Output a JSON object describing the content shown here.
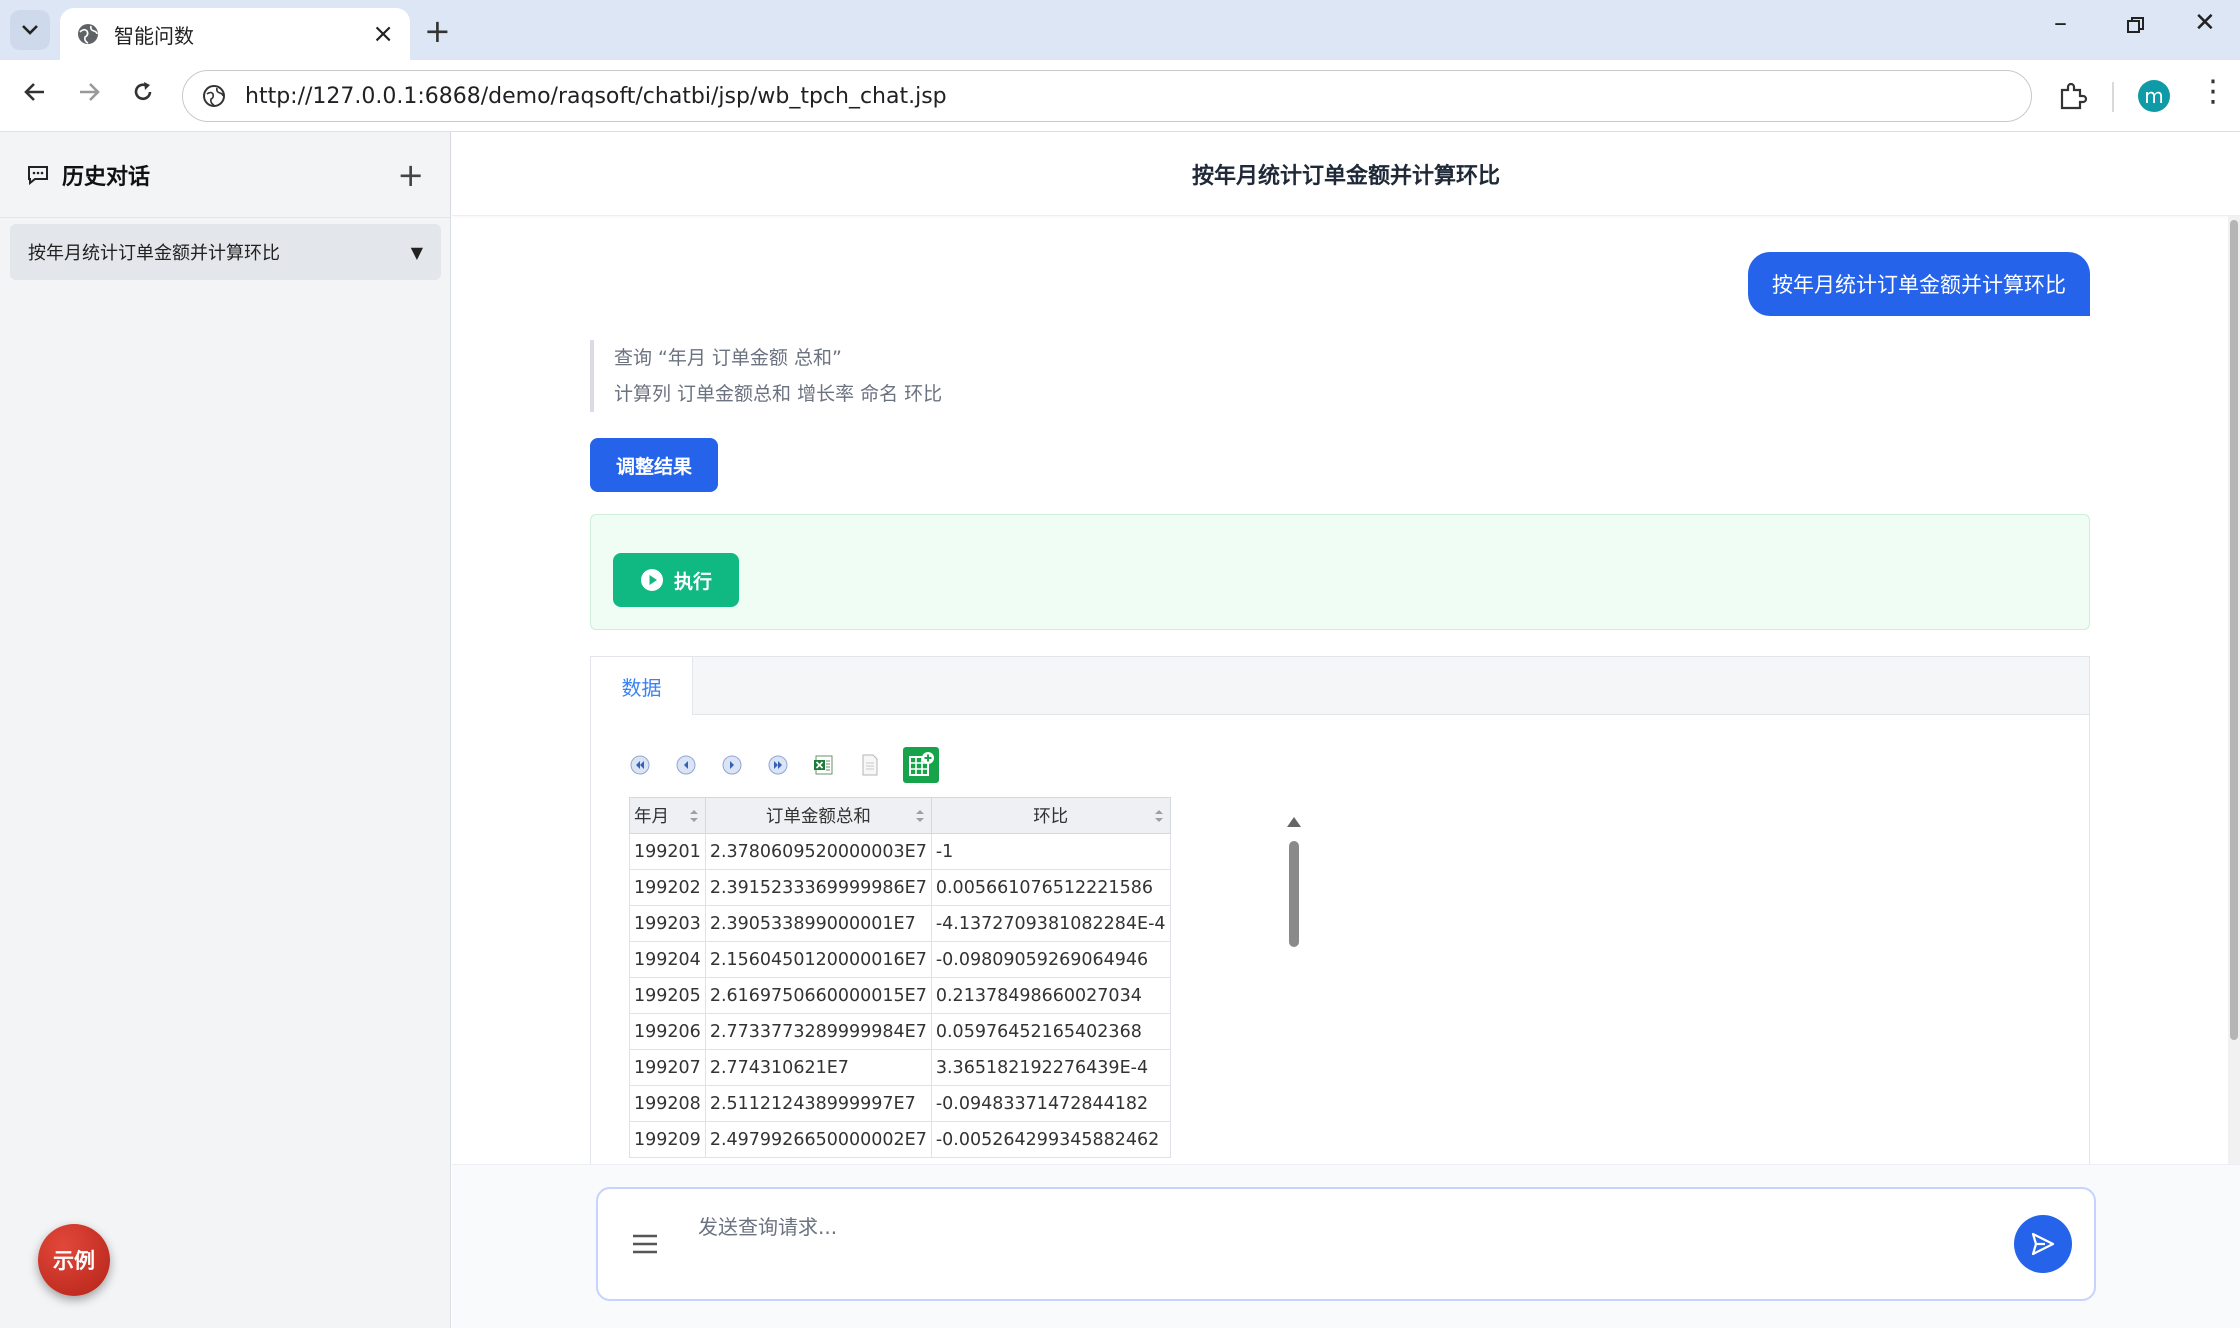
{
  "browser": {
    "tab_title": "智能问数",
    "url": "http://127.0.0.1:6868/demo/raqsoft/chatbi/jsp/wb_tpch_chat.jsp",
    "profile_initial": "m"
  },
  "sidebar": {
    "title": "历史对话",
    "history": [
      {
        "label": "按年月统计订单金额并计算环比"
      }
    ],
    "example_button": "示例"
  },
  "main": {
    "header_title": "按年月统计订单金额并计算环比",
    "user_message": "按年月统计订单金额并计算环比",
    "steps": [
      "查询 “年月 订单金额 总和”",
      "计算列 订单金额总和 增长率 命名 环比"
    ],
    "adjust_button": "调整结果",
    "execute_button": "执行",
    "data_tab": "数据"
  },
  "table": {
    "columns": [
      "年月",
      "订单金额总和",
      "环比"
    ],
    "rows": [
      [
        "199201",
        "2.3780609520000003E7",
        "-1"
      ],
      [
        "199202",
        "2.3915233369999986E7",
        "0.005661076512221586"
      ],
      [
        "199203",
        "2.390533899000001E7",
        "-4.1372709381082284E-4"
      ],
      [
        "199204",
        "2.1560450120000016E7",
        "-0.09809059269064946"
      ],
      [
        "199205",
        "2.6169750660000015E7",
        "0.21378498660027034"
      ],
      [
        "199206",
        "2.7733773289999984E7",
        "0.05976452165402368"
      ],
      [
        "199207",
        "2.774310621E7",
        "3.365182192276439E-4"
      ],
      [
        "199208",
        "2.511212438999997E7",
        "-0.09483371472844182"
      ],
      [
        "199209",
        "2.4979926650000002E7",
        "-0.005264299345882462"
      ]
    ]
  },
  "composer": {
    "placeholder": "发送查询请求..."
  },
  "colors": {
    "primary": "#2563eb",
    "execute": "#10b981",
    "example": "#c0392b",
    "sidebar_bg": "#f3f4f6"
  }
}
